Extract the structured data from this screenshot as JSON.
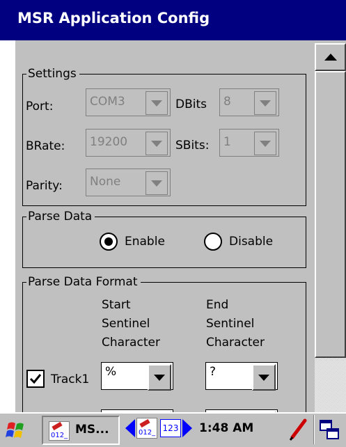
{
  "window": {
    "title": "MSR Application Config"
  },
  "settings": {
    "legend": "Settings",
    "port": {
      "label": "Port:",
      "value": "COM3"
    },
    "dbits": {
      "label": "DBits",
      "value": "8"
    },
    "brate": {
      "label": "BRate:",
      "value": "19200"
    },
    "sbits": {
      "label": "SBits:",
      "value": "1"
    },
    "parity": {
      "label": "Parity:",
      "value": "None"
    }
  },
  "parse_data": {
    "legend": "Parse Data",
    "options": [
      {
        "label": "Enable",
        "selected": true
      },
      {
        "label": "Disable",
        "selected": false
      }
    ]
  },
  "parse_format": {
    "legend": "Parse Data Format",
    "col_start": [
      "Start",
      "Sentinel",
      "Character"
    ],
    "col_end": [
      "End",
      "Sentinel",
      "Character"
    ],
    "track1": {
      "label": "Track1",
      "checked": true,
      "start": "%",
      "end": "?"
    }
  },
  "taskbar": {
    "app_button": "MS...",
    "input_mode": "123",
    "clock": "1:48 AM",
    "icons": [
      "windows-flag-icon",
      "app-thumbnail-icon",
      "left-arrow-icon",
      "right-arrow-icon",
      "pen-icon",
      "windows-switch-icon"
    ]
  },
  "colors": {
    "title_bar": "#000080",
    "face": "#c0c0c0",
    "accent_blue": "#0000ff",
    "pen_red": "#cc0000"
  }
}
